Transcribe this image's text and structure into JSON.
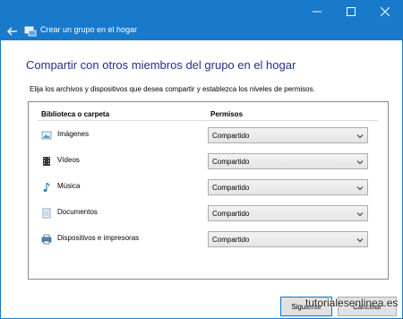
{
  "window": {
    "title": "Crear un grupo en el hogar",
    "accent": "#1979ca"
  },
  "page": {
    "heading": "Compartir con otros miembros del grupo en el hogar",
    "description": "Elija los archivos y dispositivos que desea compartir y establezca los niveles de permisos."
  },
  "list": {
    "col_library": "Biblioteca o carpeta",
    "col_permissions": "Permisos",
    "items": [
      {
        "label": "Imágenes",
        "permission": "Compartido",
        "icon": "pictures-icon"
      },
      {
        "label": "Vídeos",
        "permission": "Compartido",
        "icon": "videos-icon"
      },
      {
        "label": "Música",
        "permission": "Compartido",
        "icon": "music-icon"
      },
      {
        "label": "Documentos",
        "permission": "Compartido",
        "icon": "documents-icon"
      },
      {
        "label": "Dispositivos e impresoras",
        "permission": "Compartido",
        "icon": "printer-icon"
      }
    ]
  },
  "buttons": {
    "next": "Siguiente",
    "cancel": "Cancelar"
  },
  "watermark": "tutorialesenlinea.es"
}
